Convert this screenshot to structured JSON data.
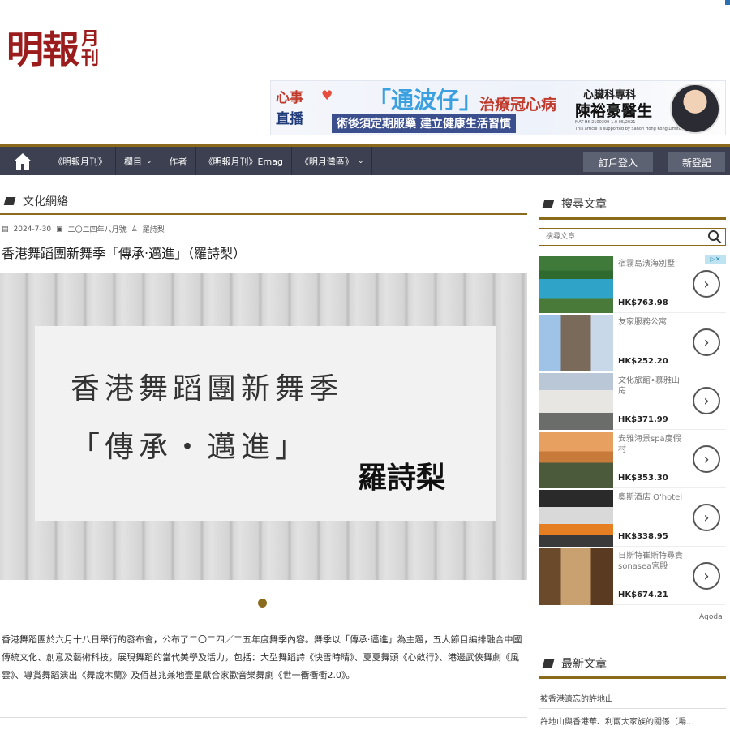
{
  "site": {
    "logo_main": "明報",
    "logo_sub": "月刊"
  },
  "banner": {
    "program_a": "心事",
    "program_b": "直播",
    "headline": "「通波仔」",
    "headline2": "治療冠心病",
    "tagline": "術後須定期服藥 建立健康生活習慣",
    "doctor_role": "心臟科專科",
    "doctor_name": "陳裕豪醫生",
    "ref": "MAT-HK-2100399-1.0 05/2021",
    "sponsor": "This article is supported by Sanofi Hong Kong Limited"
  },
  "nav": {
    "items": [
      {
        "label": "《明報月刊》",
        "dropdown": false
      },
      {
        "label": "欄目",
        "dropdown": true
      },
      {
        "label": "作者",
        "dropdown": false
      },
      {
        "label": "《明報月刊》Emag",
        "dropdown": false
      },
      {
        "label": "《明月灣區》",
        "dropdown": true
      }
    ],
    "subscriber_login": "訂戶登入",
    "register": "新登記"
  },
  "article": {
    "category": "文化網絡",
    "date": "2024-7-30",
    "issue": "二〇二四年八月號",
    "author": "羅詩梨",
    "title": "香港舞蹈團新舞季「傳承‧邁進」（羅詩梨）",
    "hero_line1": "香港舞蹈團新舞季",
    "hero_line2": "「傳承‧邁進」",
    "hero_author": "羅詩梨",
    "body": "香港舞蹈團於六月十八日舉行的發布會，公布了二〇二四／二五年度舞季內容。舞季以「傳承‧邁進」為主題，五大節目編排融合中國傳統文化、創意及藝術科技，展現舞蹈的當代美學及活力，包括：大型舞蹈詩《快雪時晴》、夏夏舞頭《心斂行》、港邊武俠舞劇《風雲》、導賞舞蹈演出《舞說木蘭》及佰甚兆兼地壹星獻合家歡音樂舞劇《世一衝衝衝2.0》。"
  },
  "sidebar": {
    "search_heading": "搜尋文章",
    "search_placeholder": "搜尋文章",
    "hotels": [
      {
        "name": "宿霧島濱海別墅",
        "price": "HK$763.98"
      },
      {
        "name": "友家服務公寓",
        "price": "HK$252.20"
      },
      {
        "name": "文化旅館•慕雅山房",
        "price": "HK$371.99"
      },
      {
        "name": "安雅海景spa度假村",
        "price": "HK$353.30"
      },
      {
        "name": "奧斯酒店 O'hotel",
        "price": "HK$338.95"
      },
      {
        "name": "日斯特崔斯特尋貴sonasea宮殿",
        "price": "HK$674.21"
      }
    ],
    "ad_provider": "Agoda",
    "latest_heading": "最新文章",
    "latest": [
      "被香港遺忘的許地山",
      "許地山與香港華、利兩大家族的關係（場..."
    ]
  },
  "colors": {
    "gold": "#8a6a1c",
    "nav_bg": "#3c4050",
    "brand_red": "#9b1c1c"
  }
}
